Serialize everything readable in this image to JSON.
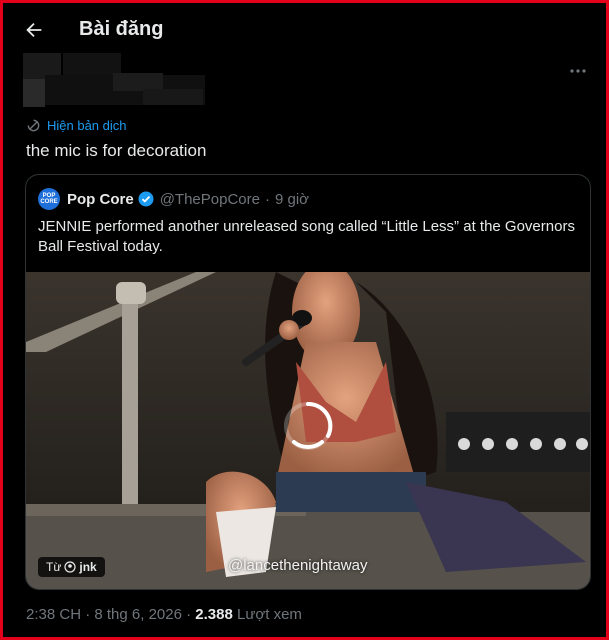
{
  "header": {
    "title": "Bài đăng"
  },
  "post": {
    "translate_label": "Hiện bản dịch",
    "text": "the mic is for decoration",
    "time": "2:38 CH",
    "separator": " · ",
    "date": "8 thg 6, 2026",
    "views_count": "2.388",
    "views_label": " Lượt xem"
  },
  "quote": {
    "avatar_text": "POP CORE",
    "name": "Pop Core",
    "handle": "@ThePopCore",
    "separator": "·",
    "time": "9 giờ",
    "text": "JENNIE performed another unreleased song called “Little Less” at the Governors Ball Festival today.",
    "media": {
      "watermark": "@lancethenightaway",
      "source_prefix": "Từ",
      "source_name": "jnk"
    }
  },
  "colors": {
    "background": "#000000",
    "accent": "#1d9bf0",
    "frame_border": "#e3001b",
    "muted_text": "#71767b"
  },
  "icons": {
    "back": "arrow-left-icon",
    "more": "more-horizontal-icon",
    "translate": "translate-icon",
    "verified": "verified-badge-icon",
    "loading": "loading-spinner-icon",
    "source": "profile-icon"
  }
}
